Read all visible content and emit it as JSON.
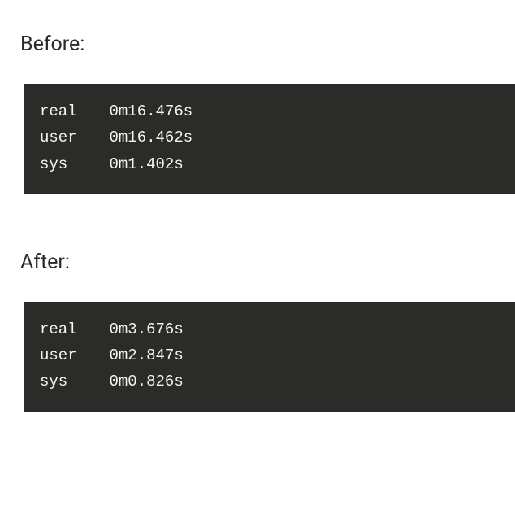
{
  "before": {
    "label": "Before:",
    "rows": [
      {
        "name": "real",
        "value": "0m16.476s"
      },
      {
        "name": "user",
        "value": "0m16.462s"
      },
      {
        "name": "sys",
        "value": "0m1.402s"
      }
    ]
  },
  "after": {
    "label": "After:",
    "rows": [
      {
        "name": "real",
        "value": "0m3.676s"
      },
      {
        "name": "user",
        "value": "0m2.847s"
      },
      {
        "name": "sys",
        "value": "0m0.826s"
      }
    ]
  }
}
